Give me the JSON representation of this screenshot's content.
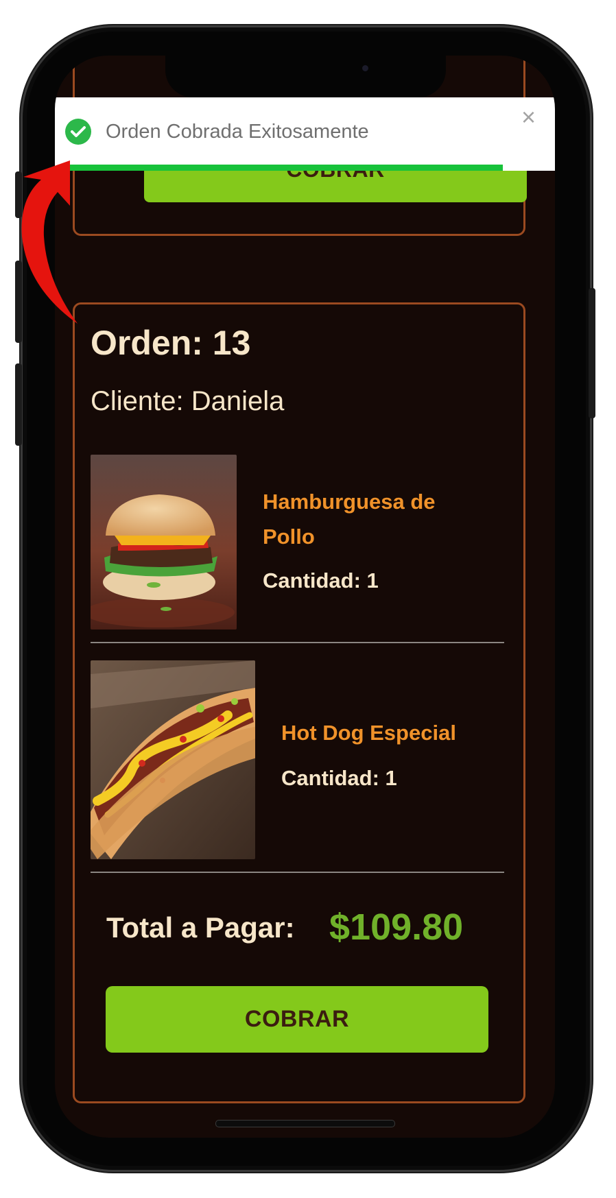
{
  "toast": {
    "message": "Orden Cobrada Exitosamente",
    "close_symbol": "×",
    "icon": "check-circle-icon",
    "progress": 0.92,
    "accent_color": "#17c23a"
  },
  "previous_order": {
    "button_label": "COBRAR"
  },
  "order": {
    "title": "Orden: 13",
    "client": "Cliente: Daniela",
    "items": [
      {
        "name": "Hamburguesa de Pollo",
        "quantity": "Cantidad: 1",
        "image": "chicken-burger-photo"
      },
      {
        "name": "Hot Dog Especial",
        "quantity": "Cantidad: 1",
        "image": "hot-dog-photo"
      }
    ],
    "total_label": "Total a Pagar:",
    "total_amount": "$109.80",
    "charge_button": "COBRAR"
  },
  "colors": {
    "background": "#150906",
    "card_border": "#9b4a20",
    "button": "#84c91b",
    "item_name": "#f0922a",
    "total_amount": "#70b12a",
    "text": "#f7e6c9"
  }
}
